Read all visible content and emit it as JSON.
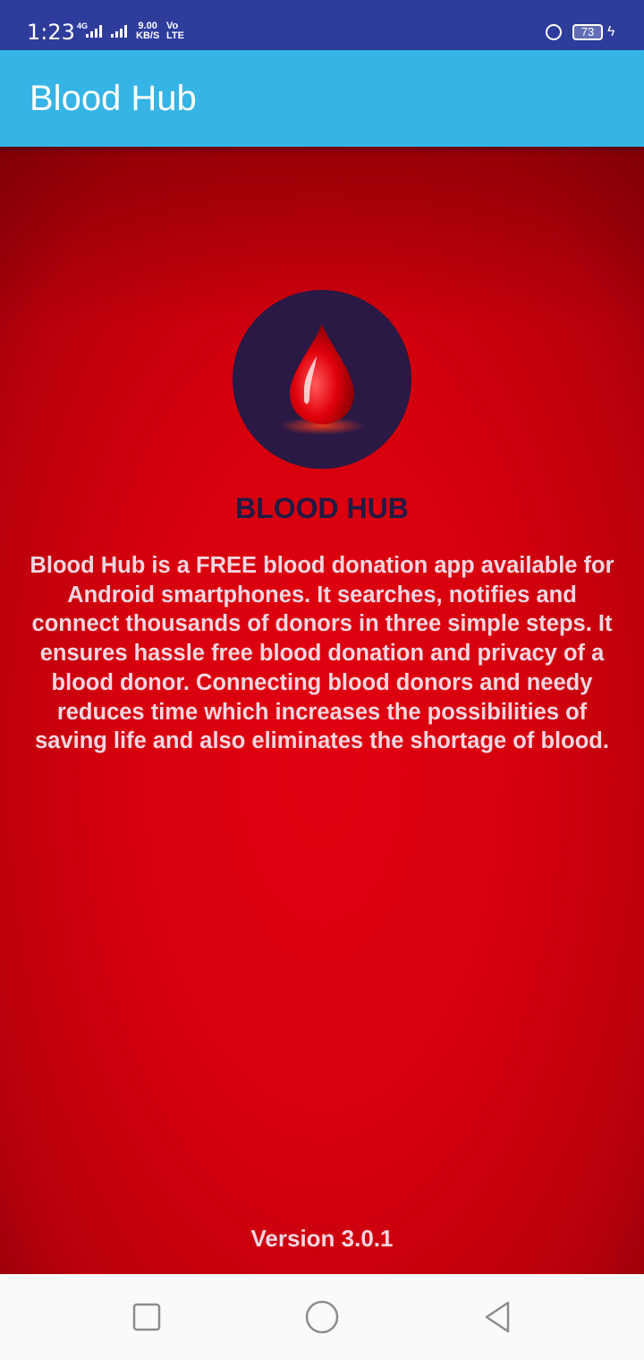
{
  "status_bar": {
    "time": "1:23",
    "network_type": "4G",
    "speed_value": "9.00",
    "speed_unit": "KB/S",
    "volte_top": "Vo",
    "volte_bottom": "LTE",
    "battery_level": "73",
    "icons": [
      "signal-icon",
      "lock-rotation-icon",
      "battery-icon",
      "charging-icon"
    ]
  },
  "app_bar": {
    "title": "Blood Hub"
  },
  "main": {
    "logo_icon": "blood-drop-icon",
    "heading": "BLOOD HUB",
    "description": "Blood Hub is a FREE blood donation app available for Android smartphones. It searches, notifies and connect thousands of donors in three simple steps. It ensures hassle free blood donation and privacy of a blood donor. Connecting blood donors and needy reduces time which increases the possibilities of saving life and also eliminates the shortage of blood.",
    "version": "Version 3.0.1"
  },
  "nav_bar": {
    "icons": [
      "recent-apps-icon",
      "home-icon",
      "back-icon"
    ]
  },
  "colors": {
    "status_bar": "#2e3c9c",
    "app_bar": "#35b4e5",
    "background_red": "#d6000d",
    "heading": "#221a44",
    "body_text": "#f1d6e0",
    "logo_circle": "#291944"
  }
}
